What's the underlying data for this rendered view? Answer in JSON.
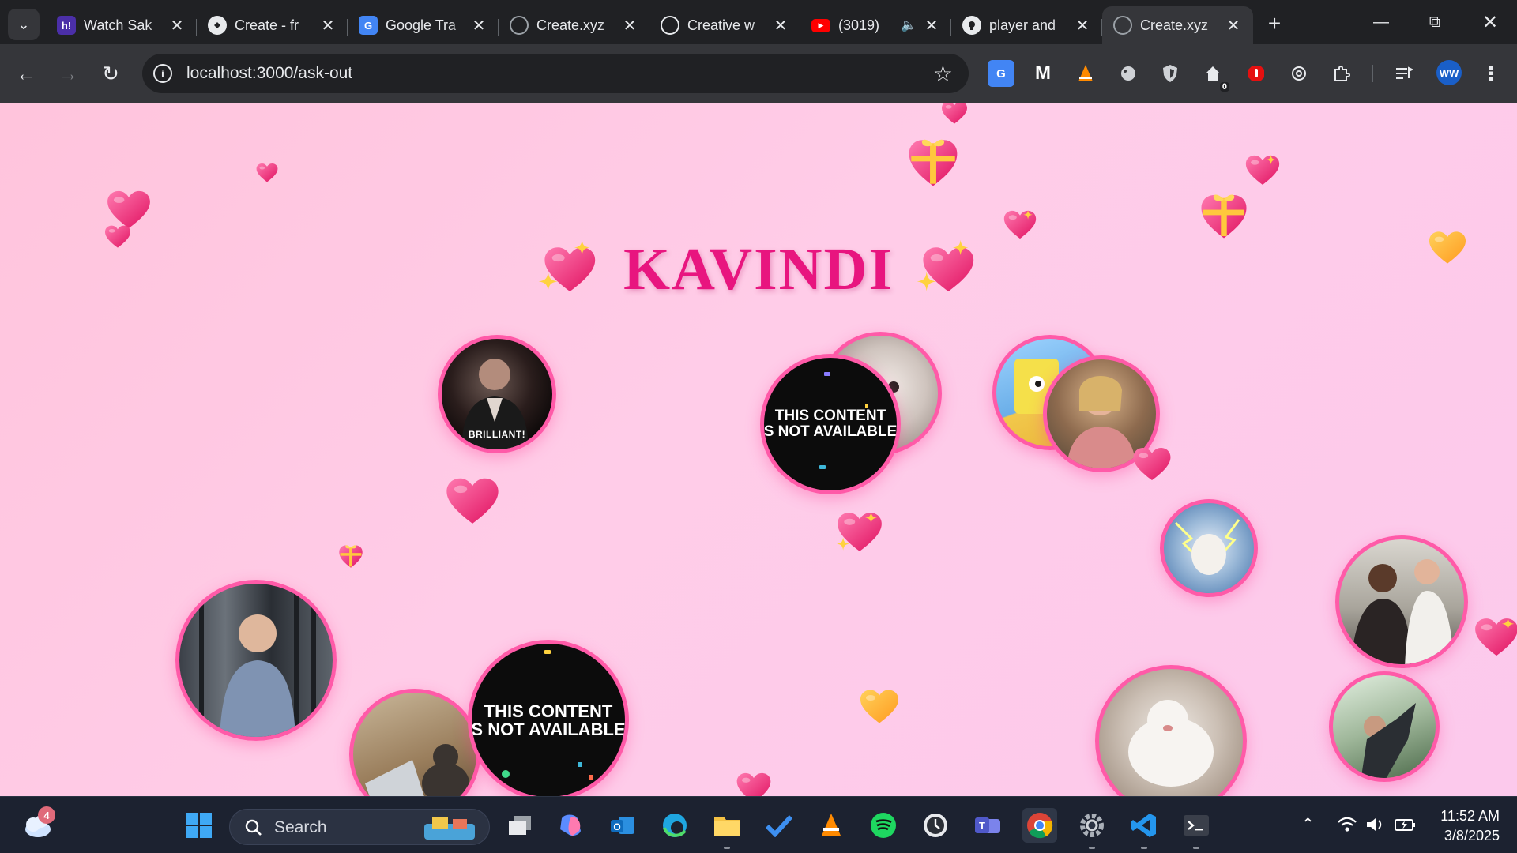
{
  "browser": {
    "tabs": [
      {
        "title": "Watch Sak",
        "favicon": "h!",
        "favicon_color": "#4b2fa8",
        "audio": false
      },
      {
        "title": "Create - fr",
        "favicon": "create-icon",
        "favicon_color": "#e8eaed",
        "audio": false
      },
      {
        "title": "Google Tra",
        "favicon": "G",
        "favicon_color": "#4285f4",
        "audio": false
      },
      {
        "title": "Create.xyz",
        "favicon": "globe-icon",
        "favicon_color": "#9aa0a6",
        "audio": false
      },
      {
        "title": "Creative w",
        "favicon": "openai-icon",
        "favicon_color": "#e8eaed",
        "audio": false
      },
      {
        "title": "(3019)",
        "favicon": "youtube-icon",
        "favicon_color": "#ff0000",
        "audio": true
      },
      {
        "title": "player and",
        "favicon": "github-icon",
        "favicon_color": "#e8eaed",
        "audio": false
      },
      {
        "title": "Create.xyz",
        "favicon": "globe-icon",
        "favicon_color": "#9aa0a6",
        "audio": false,
        "active": true
      }
    ],
    "url": "localhost:3000/ask-out",
    "profile_initials": "WW",
    "home_badge": "0"
  },
  "page": {
    "title": "KAVINDI",
    "unavailable_line1": "THIS CONTENT",
    "unavailable_line2": "S NOT AVAILABLE",
    "brilliant_caption": "BRILLIANT!",
    "accent_color": "#e8157f",
    "border_color": "#ff5aa8"
  },
  "taskbar": {
    "search_label": "Search",
    "weather_badge": "4",
    "time": "11:52 AM",
    "date": "3/8/2025"
  }
}
